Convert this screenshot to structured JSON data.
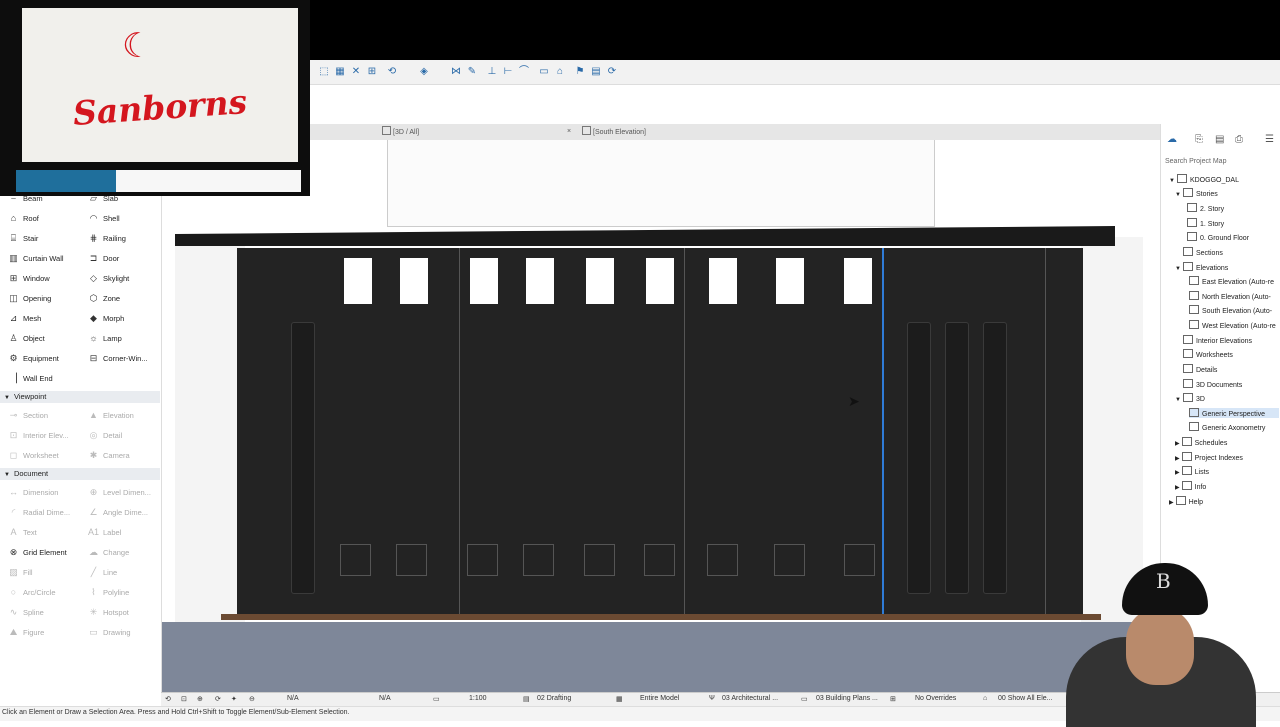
{
  "webcam": {
    "brand": "Sanborns"
  },
  "tabs": [
    {
      "label": "[3D / All]",
      "close": "×"
    },
    {
      "label": "[South Elevation]"
    }
  ],
  "toolbox": {
    "design_tools": [
      {
        "label": "Beam",
        "icon": "beam-icon"
      },
      {
        "label": "Slab",
        "icon": "slab-icon"
      },
      {
        "label": "Roof",
        "icon": "roof-icon"
      },
      {
        "label": "Shell",
        "icon": "shell-icon"
      },
      {
        "label": "Stair",
        "icon": "stair-icon"
      },
      {
        "label": "Railing",
        "icon": "railing-icon"
      },
      {
        "label": "Curtain Wall",
        "icon": "curtain-wall-icon"
      },
      {
        "label": "Door",
        "icon": "door-icon"
      },
      {
        "label": "Window",
        "icon": "window-icon"
      },
      {
        "label": "Skylight",
        "icon": "skylight-icon"
      },
      {
        "label": "Opening",
        "icon": "opening-icon"
      },
      {
        "label": "Zone",
        "icon": "zone-icon"
      },
      {
        "label": "Mesh",
        "icon": "mesh-icon"
      },
      {
        "label": "Morph",
        "icon": "morph-icon"
      },
      {
        "label": "Object",
        "icon": "object-icon"
      },
      {
        "label": "Lamp",
        "icon": "lamp-icon"
      },
      {
        "label": "Equipment",
        "icon": "equipment-icon"
      },
      {
        "label": "Corner-Win...",
        "icon": "corner-window-icon"
      },
      {
        "label": "Wall End",
        "icon": "wall-end-icon"
      }
    ],
    "viewpoint_header": "Viewpoint",
    "viewpoint_tools": [
      {
        "label": "Section",
        "icon": "section-icon"
      },
      {
        "label": "Elevation",
        "icon": "elevation-icon"
      },
      {
        "label": "Interior Elev...",
        "icon": "interior-elevation-icon"
      },
      {
        "label": "Detail",
        "icon": "detail-icon"
      },
      {
        "label": "Worksheet",
        "icon": "worksheet-icon"
      },
      {
        "label": "Camera",
        "icon": "camera-icon"
      }
    ],
    "document_header": "Document",
    "document_tools": [
      {
        "label": "Dimension",
        "icon": "dimension-icon"
      },
      {
        "label": "Level Dimen...",
        "icon": "level-dimension-icon"
      },
      {
        "label": "Radial Dime...",
        "icon": "radial-dimension-icon"
      },
      {
        "label": "Angle Dime...",
        "icon": "angle-dimension-icon"
      },
      {
        "label": "Text",
        "icon": "text-icon"
      },
      {
        "label": "Label",
        "icon": "label-icon"
      },
      {
        "label": "Grid Element",
        "icon": "grid-element-icon"
      },
      {
        "label": "Change",
        "icon": "change-icon"
      },
      {
        "label": "Fill",
        "icon": "fill-icon"
      },
      {
        "label": "Line",
        "icon": "line-icon"
      },
      {
        "label": "Arc/Circle",
        "icon": "arc-circle-icon"
      },
      {
        "label": "Polyline",
        "icon": "polyline-icon"
      },
      {
        "label": "Spline",
        "icon": "spline-icon"
      },
      {
        "label": "Hotspot",
        "icon": "hotspot-icon"
      },
      {
        "label": "Figure",
        "icon": "figure-icon"
      },
      {
        "label": "Drawing",
        "icon": "drawing-icon"
      }
    ]
  },
  "navigator": {
    "search_placeholder": "Search Project Map",
    "project": "KDOGGO_DAL",
    "items": [
      {
        "label": "Stories",
        "level": 1
      },
      {
        "label": "2. Story",
        "level": 2
      },
      {
        "label": "1. Story",
        "level": 2
      },
      {
        "label": "0. Ground Floor",
        "level": 2
      },
      {
        "label": "Sections",
        "level": 1
      },
      {
        "label": "Elevations",
        "level": 1
      },
      {
        "label": "East Elevation (Auto-re",
        "level": 2
      },
      {
        "label": "North Elevation (Auto-",
        "level": 2
      },
      {
        "label": "South Elevation (Auto-",
        "level": 2
      },
      {
        "label": "West Elevation (Auto-re",
        "level": 2
      },
      {
        "label": "Interior Elevations",
        "level": 1
      },
      {
        "label": "Worksheets",
        "level": 1
      },
      {
        "label": "Details",
        "level": 1
      },
      {
        "label": "3D Documents",
        "level": 1
      },
      {
        "label": "3D",
        "level": 1
      },
      {
        "label": "Generic Perspective",
        "level": 2,
        "selected": true
      },
      {
        "label": "Generic Axonometry",
        "level": 2
      },
      {
        "label": "Schedules",
        "level": 1
      },
      {
        "label": "Project Indexes",
        "level": 1
      },
      {
        "label": "Lists",
        "level": 1
      },
      {
        "label": "Info",
        "level": 1
      },
      {
        "label": "Help",
        "level": 1
      }
    ]
  },
  "bottom_bar": {
    "na1": "N/A",
    "na2": "N/A",
    "scale": "1:100",
    "layer_combo": "02 Drafting",
    "model": "Entire Model",
    "pen_set": "03 Architectural ...",
    "plan": "03 Building Plans ...",
    "overrides": "No Overrides",
    "show_all": "00 Show All Ele..."
  },
  "status": "Click an Element or Draw a Selection Area. Press and Hold Ctrl+Shift to Toggle Element/Sub-Element Selection.",
  "colors": {
    "accent": "#2f7bd6",
    "facade": "#232323",
    "brand": "#d4161e"
  }
}
